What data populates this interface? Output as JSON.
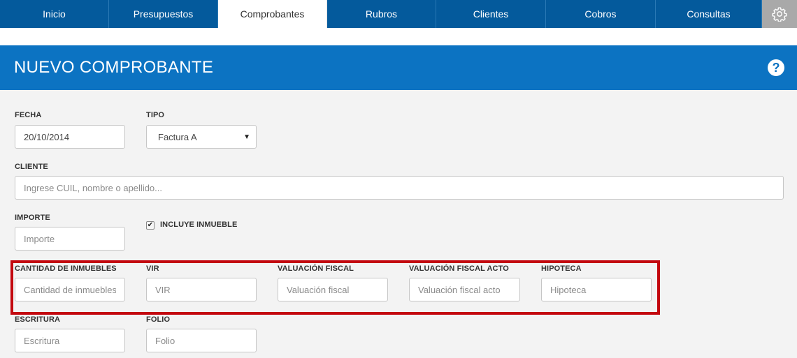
{
  "nav": {
    "tabs": [
      {
        "label": "Inicio",
        "active": false
      },
      {
        "label": "Presupuestos",
        "active": false
      },
      {
        "label": "Comprobantes",
        "active": true
      },
      {
        "label": "Rubros",
        "active": false
      },
      {
        "label": "Clientes",
        "active": false
      },
      {
        "label": "Cobros",
        "active": false
      },
      {
        "label": "Consultas",
        "active": false
      }
    ],
    "settings_icon": "gear-icon"
  },
  "header": {
    "title": "NUEVO COMPROBANTE",
    "help_icon": "help-icon",
    "help_label": "?"
  },
  "form": {
    "fecha": {
      "label": "FECHA",
      "value": "20/10/2014"
    },
    "tipo": {
      "label": "TIPO",
      "value": "Factura A"
    },
    "cliente": {
      "label": "CLIENTE",
      "placeholder": "Ingrese CUIL, nombre o apellido..."
    },
    "importe": {
      "label": "IMPORTE",
      "placeholder": "Importe"
    },
    "incluye_inmueble": {
      "label": "INCLUYE INMUEBLE",
      "checked": true
    },
    "cantidad_inmuebles": {
      "label": "CANTIDAD DE INMUEBLES",
      "placeholder": "Cantidad de inmuebles"
    },
    "vir": {
      "label": "VIR",
      "placeholder": "VIR"
    },
    "valuacion_fiscal": {
      "label": "VALUACIÓN FISCAL",
      "placeholder": "Valuación fiscal"
    },
    "valuacion_fiscal_acto": {
      "label": "VALUACIÓN FISCAL ACTO",
      "placeholder": "Valuación fiscal acto"
    },
    "hipoteca": {
      "label": "HIPOTECA",
      "placeholder": "Hipoteca"
    },
    "escritura": {
      "label": "ESCRITURA",
      "placeholder": "Escritura"
    },
    "folio": {
      "label": "FOLIO",
      "placeholder": "Folio"
    }
  },
  "colors": {
    "nav_bg": "#045a9c",
    "header_bg": "#0c73c2",
    "highlight": "#c3070f",
    "form_bg": "#f3f3f3"
  }
}
